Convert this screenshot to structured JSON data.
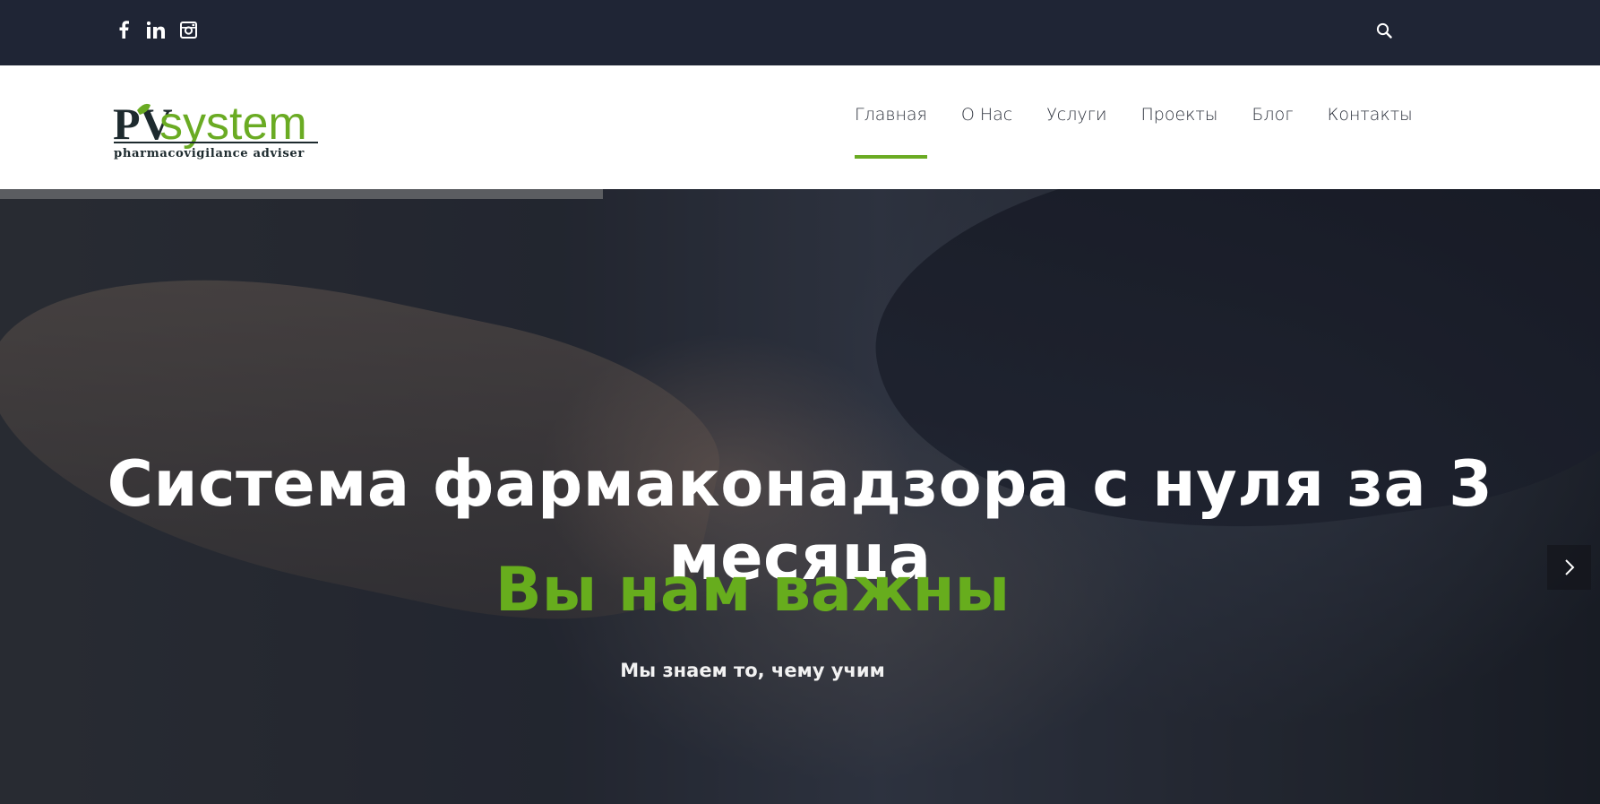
{
  "topbar": {
    "social": [
      {
        "icon": "facebook-icon",
        "glyph": "f"
      },
      {
        "icon": "linkedin-icon",
        "glyph": "in"
      },
      {
        "icon": "instagram-icon",
        "glyph": ""
      }
    ],
    "search_icon": "search-icon"
  },
  "header": {
    "logo": {
      "brand_pv": "PV",
      "brand_system": "system",
      "tagline": "pharmacovigilance adviser"
    },
    "nav": [
      {
        "label": "Главная",
        "active": true
      },
      {
        "label": "О Нас",
        "active": false
      },
      {
        "label": "Услуги",
        "active": false
      },
      {
        "label": "Проекты",
        "active": false
      },
      {
        "label": "Блог",
        "active": false
      },
      {
        "label": "Контакты",
        "active": false
      }
    ]
  },
  "hero": {
    "title": "Система фармаконадзора с нуля за 3 месяца",
    "subtitle": "Вы нам важны",
    "tagline": "Мы знаем то, чему учим",
    "next_icon": "chevron-right-icon"
  },
  "colors": {
    "accent": "#6aab23",
    "topbar_bg": "#1f2535",
    "header_bg": "#ffffff"
  }
}
